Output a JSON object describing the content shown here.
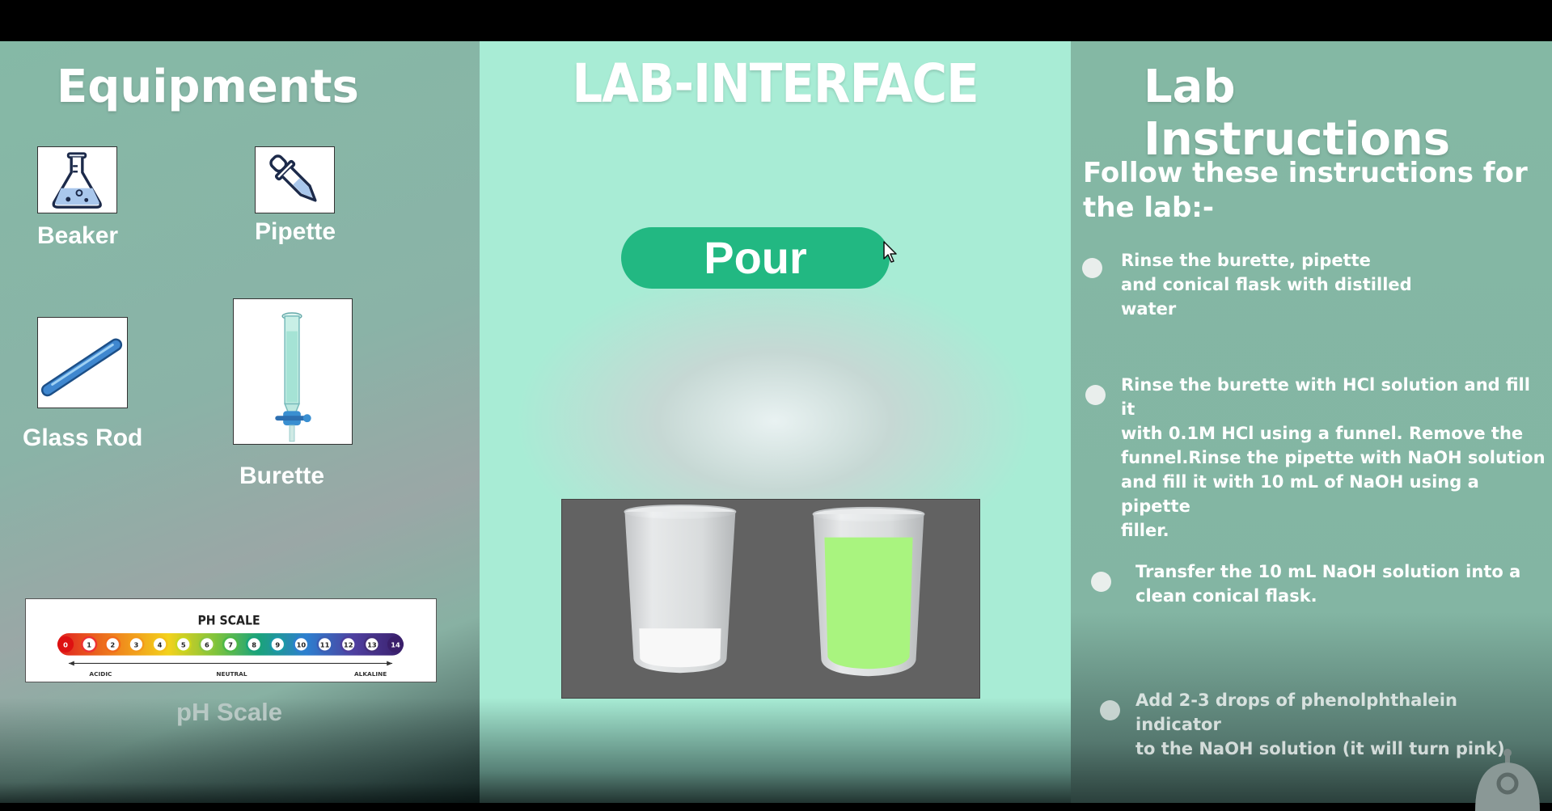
{
  "equipments": {
    "title": "Equipments",
    "items": [
      {
        "label": "Beaker",
        "icon": "beaker-icon"
      },
      {
        "label": "Pipette",
        "icon": "pipette-icon"
      },
      {
        "label": "Glass Rod",
        "icon": "glass-rod-icon"
      },
      {
        "label": "Burette",
        "icon": "burette-icon"
      }
    ],
    "ph_scale": {
      "label": "pH Scale",
      "image_title": "PH SCALE",
      "numbers": [
        "0",
        "1",
        "2",
        "3",
        "4",
        "5",
        "6",
        "7",
        "8",
        "9",
        "10",
        "11",
        "12",
        "13",
        "14"
      ],
      "acidic": "ACIDIC",
      "neutral": "NEUTRAL",
      "alkaline": "ALKALINE"
    }
  },
  "lab": {
    "title": "LAB-INTERFACE",
    "pour_label": "Pour",
    "beakers": [
      {
        "name": "left-beaker",
        "fill_level": 0.25,
        "liquid_color": "#f8f8f8"
      },
      {
        "name": "right-beaker",
        "fill_level": 0.85,
        "liquid_color": "#a9f47f"
      }
    ]
  },
  "instructions": {
    "title": "Lab Instructions",
    "subtitle": "Follow these instructions for the lab:-",
    "steps": [
      "Rinse the burette, pipette\nand conical flask with distilled\nwater",
      "Rinse the burette with HCl solution and fill it\nwith 0.1M HCl using a funnel. Remove the\nfunnel.Rinse the pipette with NaOH solution\nand fill it with 10 mL of NaOH using a pipette\nfiller.",
      "Transfer the 10 mL NaOH solution into a\nclean conical flask.",
      "Add 2-3 drops of phenolphthalein indicator\nto the NaOH solution (it will turn pink)."
    ]
  },
  "colors": {
    "accent": "#22b882",
    "panel": "#85b9a6",
    "center": "#a8ecd5"
  }
}
